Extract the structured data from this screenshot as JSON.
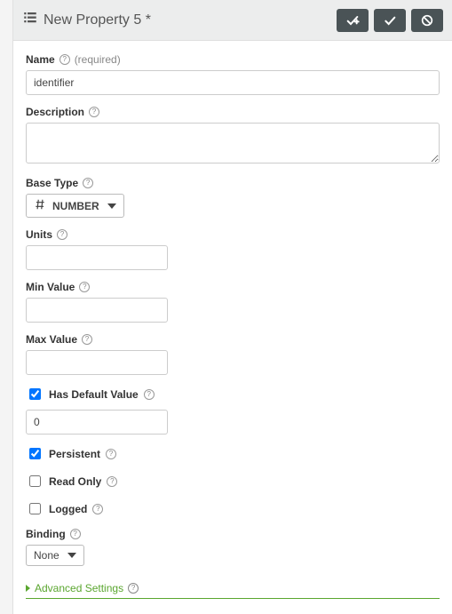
{
  "header": {
    "title": "New Property 5 *"
  },
  "fields": {
    "name": {
      "label": "Name",
      "required_hint": "(required)",
      "value": "identifier"
    },
    "description": {
      "label": "Description",
      "value": ""
    },
    "baseType": {
      "label": "Base Type",
      "value": "NUMBER"
    },
    "units": {
      "label": "Units",
      "value": ""
    },
    "minValue": {
      "label": "Min Value",
      "value": ""
    },
    "maxValue": {
      "label": "Max Value",
      "value": ""
    },
    "hasDefault": {
      "label": "Has Default Value"
    },
    "defaultValue": {
      "value": "0"
    },
    "persistent": {
      "label": "Persistent"
    },
    "readOnly": {
      "label": "Read Only"
    },
    "logged": {
      "label": "Logged"
    },
    "binding": {
      "label": "Binding",
      "value": "None"
    }
  },
  "advanced": {
    "label": "Advanced Settings"
  }
}
